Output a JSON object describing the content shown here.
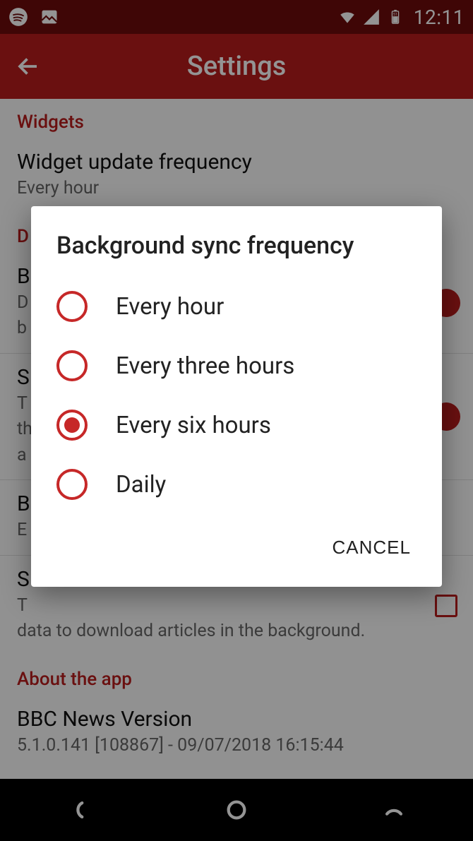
{
  "status_bar": {
    "time": "12:11",
    "battery_level": "51"
  },
  "app_bar": {
    "title": "Settings"
  },
  "sections": {
    "widgets": {
      "header": "Widgets",
      "update_freq": {
        "title": "Widget update frequency",
        "sub": "Every hour"
      }
    },
    "data": {
      "header": "D",
      "bg_sync": {
        "title": "B",
        "sub1": "D",
        "sub2": "b"
      },
      "sync_wifi": {
        "title": "S",
        "sub1": "T",
        "sub2": "th",
        "sub3": "a"
      },
      "bg_freq": {
        "title": "B",
        "sub": "E"
      },
      "sync_cell": {
        "title": "S",
        "sub1": "T",
        "sub2": "data to download articles in the background."
      }
    },
    "about": {
      "header": "About the app",
      "version": {
        "title": "BBC News Version",
        "sub": "5.1.0.141 [108867] - 09/07/2018 16:15:44"
      }
    }
  },
  "dialog": {
    "title": "Background sync frequency",
    "options": [
      {
        "label": "Every hour",
        "selected": false
      },
      {
        "label": "Every three hours",
        "selected": false
      },
      {
        "label": "Every six hours",
        "selected": true
      },
      {
        "label": "Daily",
        "selected": false
      }
    ],
    "cancel": "CANCEL"
  }
}
